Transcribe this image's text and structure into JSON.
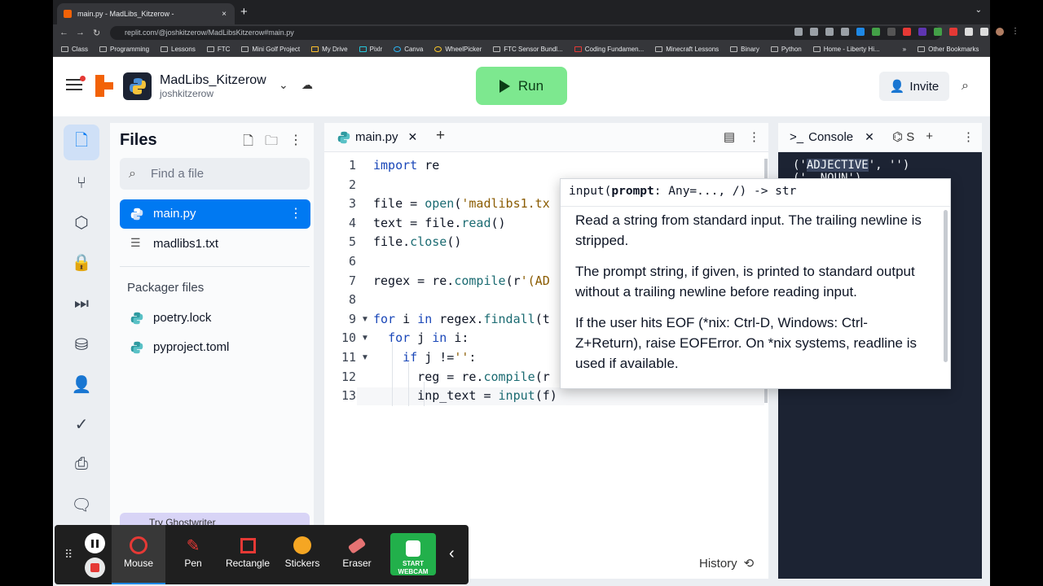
{
  "browser": {
    "tab_title": "main.py - MadLibs_Kitzerow -",
    "tab_close": "×",
    "new_tab": "+",
    "url": "replit.com/@joshkitzerow/MadLibsKitzerow#main.py",
    "bookmarks": [
      "Class",
      "Programming",
      "Lessons",
      "FTC",
      "Mini Golf Project",
      "My Drive",
      "Pixlr",
      "Canva",
      "WheelPicker",
      "FTC Sensor Bundl...",
      "Coding Fundamen...",
      "Minecraft Lessons",
      "Binary",
      "Python",
      "Home - Liberty Hi..."
    ],
    "bookmarks_more": "»",
    "other_bookmarks": "Other Bookmarks"
  },
  "header": {
    "project_name": "MadLibs_Kitzerow",
    "owner": "joshkitzerow",
    "run_label": "Run",
    "invite_label": "Invite"
  },
  "files": {
    "title": "Files",
    "search_placeholder": "Find a file",
    "items": [
      "main.py",
      "madlibs1.txt"
    ],
    "packager_title": "Packager files",
    "packager_items": [
      "poetry.lock",
      "pyproject.toml"
    ],
    "ghostwriter": "Try Ghostwriter"
  },
  "editor": {
    "tab_name": "main.py",
    "lines": [
      {
        "n": "1",
        "code": "import re"
      },
      {
        "n": "2",
        "code": ""
      },
      {
        "n": "3",
        "code": "file = open('madlibs1.tx"
      },
      {
        "n": "4",
        "code": "text = file.read()"
      },
      {
        "n": "5",
        "code": "file.close()"
      },
      {
        "n": "6",
        "code": ""
      },
      {
        "n": "7",
        "code": "regex = re.compile(r'(AD"
      },
      {
        "n": "8",
        "code": ""
      },
      {
        "n": "9",
        "code": "for i in regex.findall(t"
      },
      {
        "n": "10",
        "code": "  for j in i:"
      },
      {
        "n": "11",
        "code": "    if j !='':"
      },
      {
        "n": "12",
        "code": "      reg = re.compile(r"
      },
      {
        "n": "13",
        "code": "      inp_text = input(f)"
      }
    ],
    "history_label": "History"
  },
  "console": {
    "tab_label": "Console",
    "second_tab": "S",
    "output_line1_pre": "('",
    "output_line1_hl": "ADJECTIVE",
    "output_line1_post": "', '')",
    "output_line2": "('  NOUN')"
  },
  "tooltip": {
    "signature_pre": "input(",
    "signature_param": "prompt",
    "signature_post": ": Any=..., /) -> str",
    "p1": "Read a string from standard input.  The trailing newline is stripped.",
    "p2": "The prompt string, if given, is printed to standard output without a trailing newline before reading input.",
    "p3": "If the user hits EOF (*nix: Ctrl-D, Windows: Ctrl-Z+Return), raise EOFError. On *nix systems, readline is used if available."
  },
  "recorder": {
    "tools": [
      "Mouse",
      "Pen",
      "Rectangle",
      "Stickers",
      "Eraser"
    ],
    "webcam_line1": "START",
    "webcam_line2": "WEBCAM"
  },
  "colors": {
    "run_green": "#7de88f",
    "accent_blue": "#0079f2",
    "console_bg": "#1c2333",
    "replit_orange": "#f26207"
  }
}
